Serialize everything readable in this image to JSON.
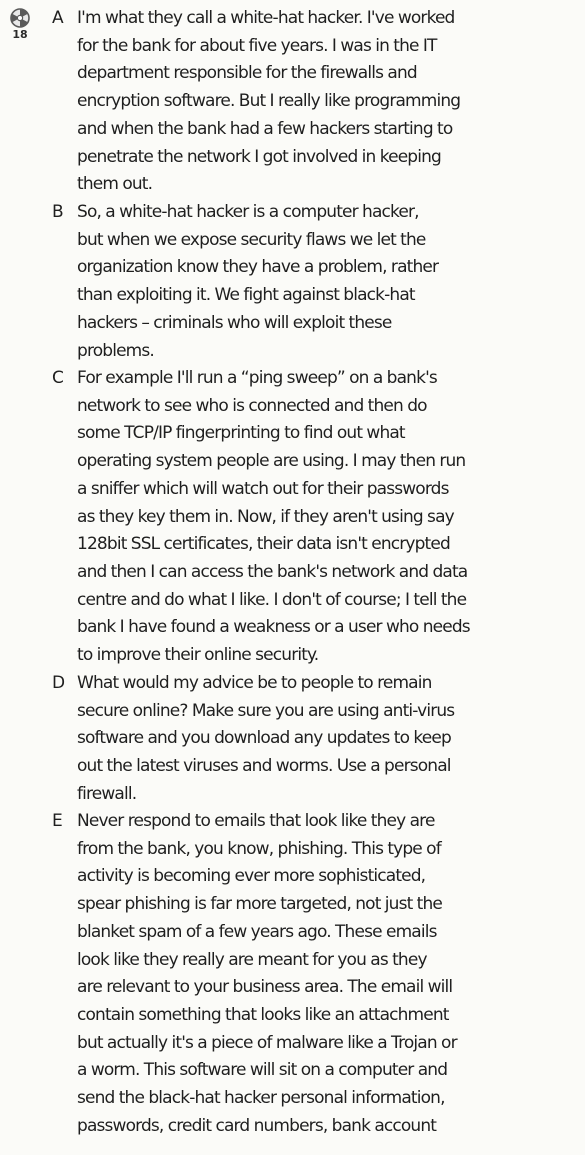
{
  "track_number": "18",
  "paragraphs": [
    {
      "letter": "A",
      "lines": [
        "I'm what they call a white-hat hacker. I've worked",
        "for the bank for about five years. I was in the IT",
        "department responsible for the firewalls and",
        "encryption software. But I really like programming",
        "and when the bank had a few hackers starting to",
        "penetrate the network I got involved in keeping",
        "them out."
      ]
    },
    {
      "letter": "B",
      "lines": [
        "So, a white-hat hacker is a computer hacker,",
        "but when we expose security flaws we let the",
        "organization know they have a problem, rather",
        "than exploiting it. We fight against black-hat",
        "hackers – criminals who will exploit these",
        "problems."
      ]
    },
    {
      "letter": "C",
      "lines": [
        "For example I'll run a “ping sweep” on a bank's",
        "network to see who is connected and then do",
        "some TCP/IP fingerprinting to find out what",
        "operating system people are using. I may then run",
        "a sniffer which will watch out for their passwords",
        "as they key them in. Now, if they aren't using say",
        "128bit SSL certificates, their data isn't encrypted",
        "and then I can access the bank's network and data",
        "centre and do what I like. I don't of course; I tell the",
        "bank I have found a weakness or a user who needs",
        "to improve their online security."
      ]
    },
    {
      "letter": "D",
      "lines": [
        "What would my advice be to people to remain",
        "secure online? Make sure you are using anti-virus",
        "software and you download any updates to keep",
        "out the latest viruses and worms. Use a personal",
        "firewall."
      ]
    },
    {
      "letter": "E",
      "lines": [
        "Never respond to emails that look like they are",
        "from the bank, you know, phishing. This type of",
        "activity is becoming ever more sophisticated,",
        "spear phishing is far more targeted, not just the",
        "blanket spam of a few years ago. These emails",
        "look like they really are meant for you as they",
        "are relevant to your business area. The email will",
        "contain something that looks like an attachment",
        "but actually it's a piece of malware like a Trojan or",
        "a worm. This software will sit on a computer and",
        "send the black-hat hacker personal information,",
        "passwords, credit card numbers, bank account"
      ]
    }
  ]
}
